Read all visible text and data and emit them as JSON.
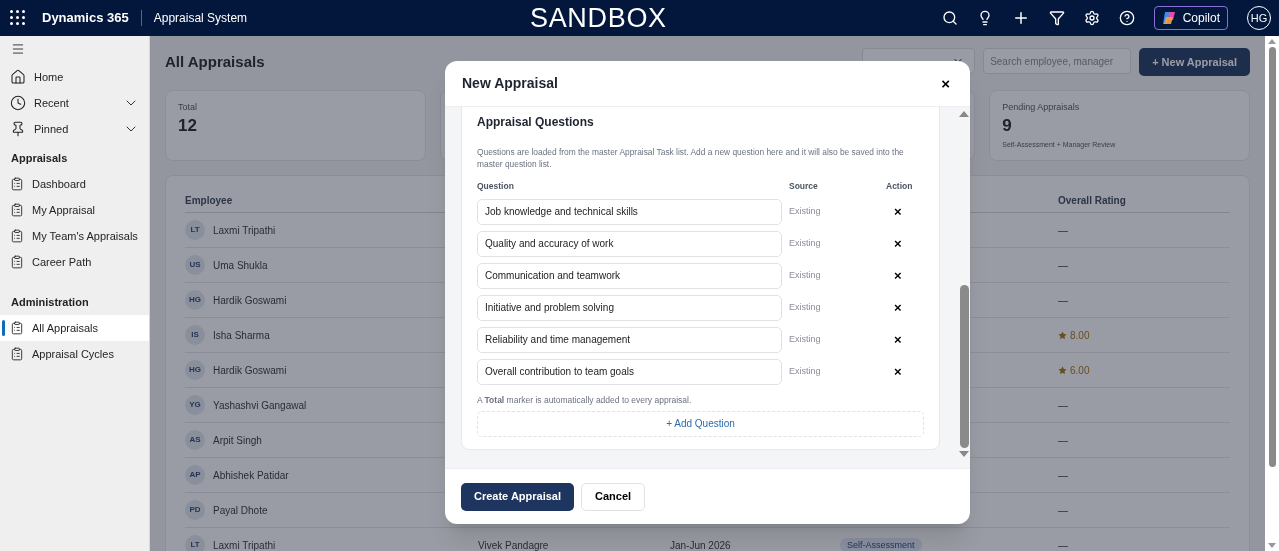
{
  "header": {
    "app_name": "Dynamics 365",
    "area_name": "Appraisal System",
    "environment": "SANDBOX",
    "copilot_label": "Copilot",
    "avatar_initials": "HG"
  },
  "sidebar": {
    "top_items": [
      {
        "label": "Home",
        "expandable": false
      },
      {
        "label": "Recent",
        "expandable": true
      },
      {
        "label": "Pinned",
        "expandable": true
      }
    ],
    "sections": [
      {
        "title": "Appraisals",
        "items": [
          {
            "label": "Dashboard",
            "selected": false
          },
          {
            "label": "My Appraisal",
            "selected": false
          },
          {
            "label": "My Team's Appraisals",
            "selected": false
          },
          {
            "label": "Career Path",
            "selected": false
          }
        ]
      },
      {
        "title": "Administration",
        "items": [
          {
            "label": "All Appraisals",
            "selected": true
          },
          {
            "label": "Appraisal Cycles",
            "selected": false
          }
        ]
      }
    ]
  },
  "page": {
    "title": "All Appraisals",
    "search_placeholder": "Search employee, manager",
    "new_button": "+ New Appraisal"
  },
  "stats": [
    {
      "label": "Total",
      "value": "12"
    },
    {
      "label": "Pending Appraisals",
      "value": "9",
      "caption": "Self-Assessment + Manager Review"
    }
  ],
  "table": {
    "columns": [
      "Employee",
      "Overall Rating"
    ],
    "rows": [
      {
        "initials": "LT",
        "name": "Laxmi Tripathi",
        "rating": "—",
        "kind": "empty"
      },
      {
        "initials": "US",
        "name": "Uma Shukla",
        "rating": "—",
        "kind": "empty"
      },
      {
        "initials": "HG",
        "name": "Hardik Goswami",
        "rating": "—",
        "kind": "empty"
      },
      {
        "initials": "IS",
        "name": "Isha Sharma",
        "rating": "8.00",
        "kind": "score"
      },
      {
        "initials": "HG",
        "name": "Hardik Goswami",
        "rating": "6.00",
        "kind": "score"
      },
      {
        "initials": "YG",
        "name": "Yashashvi Gangawal",
        "rating": "—",
        "kind": "empty"
      },
      {
        "initials": "AS",
        "name": "Arpit Singh",
        "rating": "—",
        "kind": "empty"
      },
      {
        "initials": "AP",
        "name": "Abhishek Patidar",
        "rating": "—",
        "kind": "empty"
      },
      {
        "initials": "PD",
        "name": "Payal Dhote",
        "rating": "—",
        "kind": "empty"
      },
      {
        "initials": "LT",
        "name": "Laxmi Tripathi",
        "manager": "Vivek Pandagre",
        "cycle": "Jan-Jun 2026",
        "status": "Self-Assessment",
        "rating": "—",
        "kind": "empty"
      }
    ]
  },
  "modal": {
    "title": "New Appraisal",
    "close": "×",
    "section_title": "Appraisal Questions",
    "description": "Questions are loaded from the master Appraisal Task list. Add a new question here and it will also be saved into the master question list.",
    "columns": [
      "Question",
      "Source",
      "Action"
    ],
    "questions": [
      {
        "text": "Job knowledge and technical skills",
        "source": "Existing",
        "remove": "×"
      },
      {
        "text": "Quality and accuracy of work",
        "source": "Existing",
        "remove": "×"
      },
      {
        "text": "Communication and teamwork",
        "source": "Existing",
        "remove": "×"
      },
      {
        "text": "Initiative and problem solving",
        "source": "Existing",
        "remove": "×"
      },
      {
        "text": "Reliability and time management",
        "source": "Existing",
        "remove": "×"
      },
      {
        "text": "Overall contribution to team goals",
        "source": "Existing",
        "remove": "×"
      }
    ],
    "note": "A **Total** marker is automatically added to every appraisal.",
    "add_button": "+ Add Question",
    "buttons": [
      {
        "label": "Create Appraisal",
        "kind": "primary"
      },
      {
        "label": "Cancel",
        "kind": "secondary"
      }
    ]
  }
}
